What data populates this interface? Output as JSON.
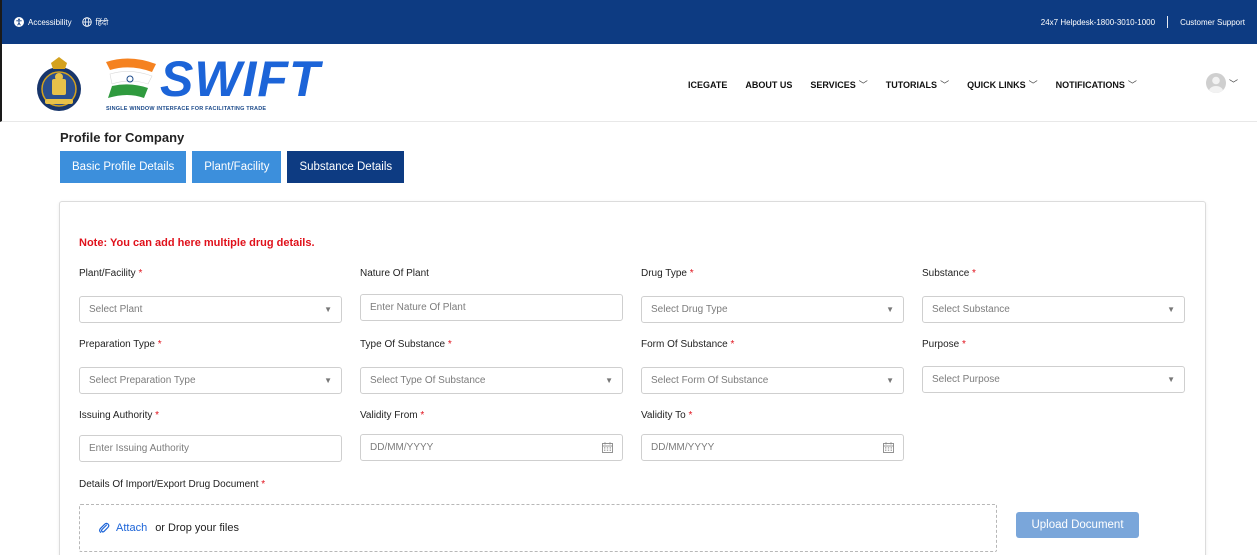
{
  "topbar": {
    "accessibility": "Accessibility",
    "hindi": "हिंदी",
    "helpdesk": "24x7 Helpdesk-1800-3010-1000",
    "support": "Customer Support"
  },
  "brand": {
    "name": "SWIFT",
    "tagline": "SINGLE WINDOW INTERFACE FOR FACILITATING TRADE"
  },
  "nav": {
    "items": [
      "ICEGATE",
      "ABOUT US",
      "SERVICES",
      "TUTORIALS",
      "QUICK LINKS",
      "NOTIFICATIONS"
    ]
  },
  "page": {
    "title": "Profile for Company",
    "tabs": [
      "Basic Profile Details",
      "Plant/Facility",
      "Substance Details"
    ]
  },
  "form": {
    "note": "Note: You can add here multiple drug details.",
    "fields": [
      {
        "label": "Plant/Facility",
        "required": "*",
        "placeholder": "Select Plant"
      },
      {
        "label": "Nature Of Plant",
        "required": "",
        "placeholder": "Enter Nature Of Plant"
      },
      {
        "label": "Drug Type",
        "required": "*",
        "placeholder": "Select Drug Type"
      },
      {
        "label": "Substance",
        "required": "*",
        "placeholder": "Select Substance"
      },
      {
        "label": "Preparation Type",
        "required": "*",
        "placeholder": "Select Preparation Type"
      },
      {
        "label": "Type Of Substance",
        "required": "*",
        "placeholder": "Select Type Of Substance"
      },
      {
        "label": "Form Of Substance",
        "required": "*",
        "placeholder": "Select Form Of Substance"
      },
      {
        "label": "Purpose",
        "required": "*",
        "placeholder": "Select Purpose"
      },
      {
        "label": "Issuing Authority",
        "required": "*",
        "placeholder": "Enter Issuing Authority"
      },
      {
        "label": "Validity From",
        "required": "*",
        "placeholder": "DD/MM/YYYY"
      },
      {
        "label": "Validity To",
        "required": "*",
        "placeholder": "DD/MM/YYYY"
      }
    ],
    "document": {
      "label": "Details Of Import/Export Drug Document",
      "required": "*",
      "attach": "Attach",
      "drop": "or Drop your files",
      "upload": "Upload Document"
    }
  },
  "colors": {
    "topbar": "#0d3b82",
    "tab_active": "#0d3b82",
    "tab": "#3c8fdc",
    "required": "#e0111b",
    "link": "#1c64d8",
    "upload_button": "#7aa6da"
  }
}
